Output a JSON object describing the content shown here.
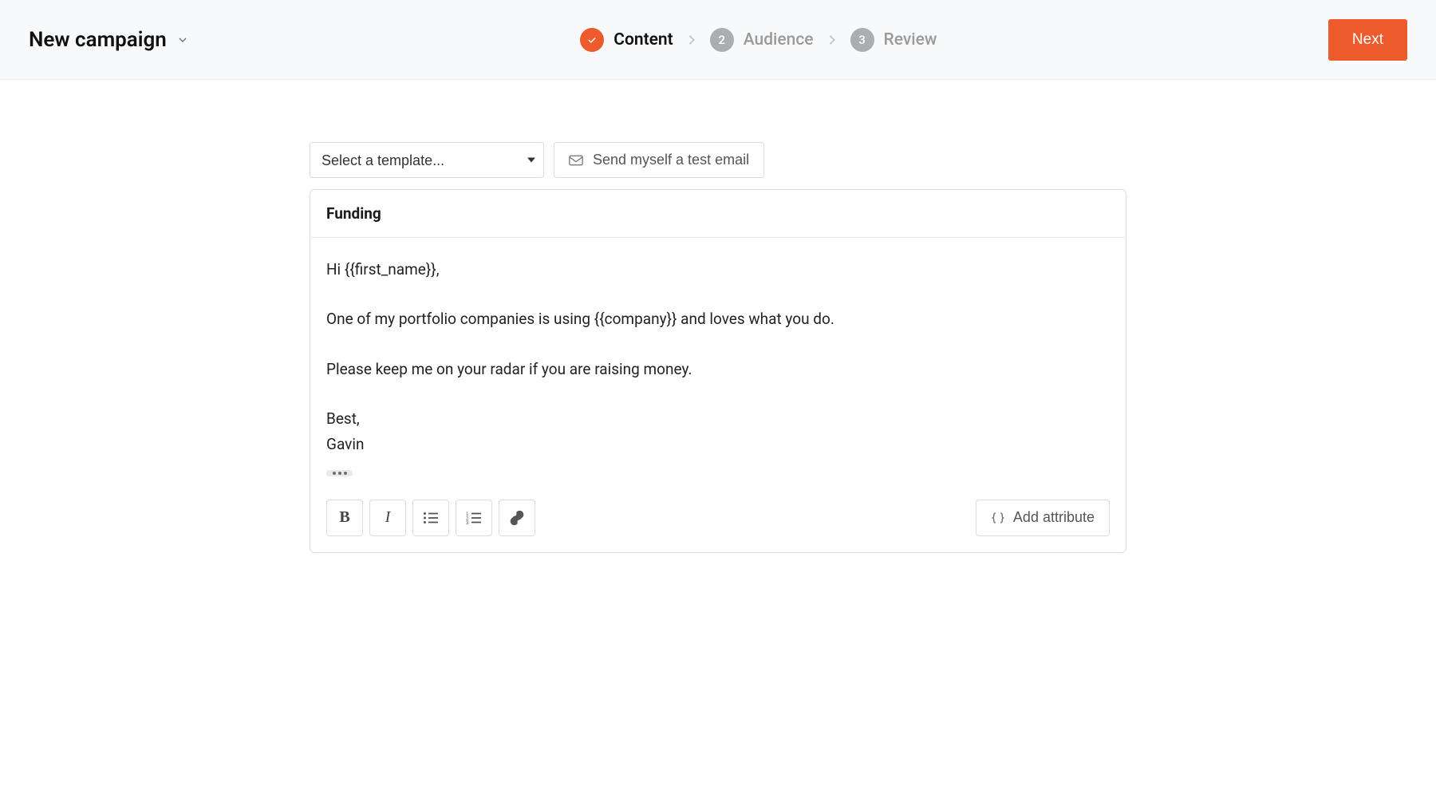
{
  "header": {
    "title": "New campaign",
    "next_button_label": "Next",
    "steps": [
      {
        "label": "Content",
        "state": "done_active"
      },
      {
        "label": "Audience",
        "number": "2",
        "state": "upcoming"
      },
      {
        "label": "Review",
        "number": "3",
        "state": "upcoming"
      }
    ]
  },
  "toolbar": {
    "template_select_placeholder": "Select a template...",
    "send_test_label": "Send myself a test email"
  },
  "editor": {
    "subject": "Funding",
    "body_lines": [
      "Hi {{first_name}},",
      "One of my portfolio companies is using {{company}} and loves what you do.",
      "Please keep me on your radar if you are raising money.",
      "Best,",
      "Gavin"
    ],
    "add_attribute_label": "Add attribute"
  }
}
